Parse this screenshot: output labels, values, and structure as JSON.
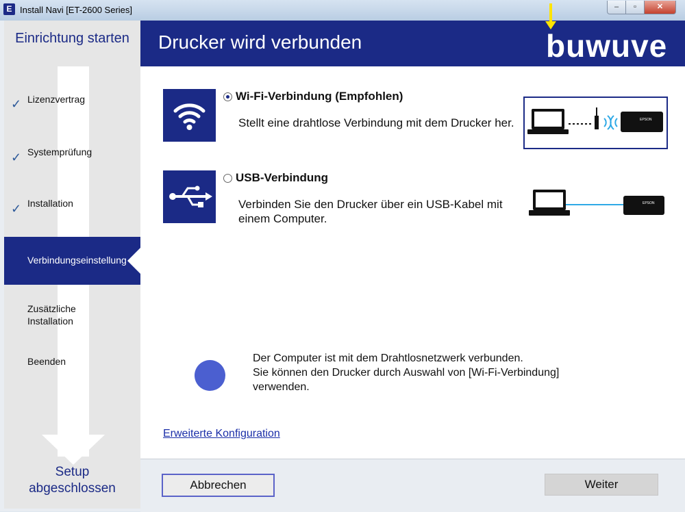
{
  "window": {
    "app_icon": "E",
    "title": "Install Navi [ET-2600 Series]",
    "controls": {
      "minimize": "–",
      "maximize": "▫",
      "close": "✕"
    }
  },
  "sidebar": {
    "title": "Einrichtung starten",
    "steps": [
      {
        "label": "Lizenzvertrag",
        "done": true
      },
      {
        "label": "Systemprüfung",
        "done": true
      },
      {
        "label": "Installation",
        "done": true
      },
      {
        "label": "Verbindungseinstellung",
        "active": true
      },
      {
        "label": "Zusätzliche Installation"
      },
      {
        "label": "Beenden"
      }
    ],
    "footer_line1": "Setup",
    "footer_line2": "abgeschlossen",
    "check_glyph": "✓"
  },
  "header": {
    "title": "Drucker wird verbunden",
    "brand": "buwuve"
  },
  "options": [
    {
      "icon": "wifi-icon",
      "title": "Wi-Fi-Verbindung (Empfohlen)",
      "desc": "Stellt eine drahtlose Verbindung mit dem Drucker her.",
      "selected": true
    },
    {
      "icon": "usb-icon",
      "title": "USB-Verbindung",
      "desc": "Verbinden Sie den Drucker über ein USB-Kabel mit einem Computer.",
      "selected": false
    }
  ],
  "diagrams": {
    "printer_label": "EPSON"
  },
  "info": {
    "line1": "Der Computer ist mit dem Drahtlosnetzwerk verbunden.",
    "line2": "Sie können den Drucker durch Auswahl von [Wi-Fi-Verbindung]",
    "line3": "verwenden."
  },
  "advanced_link": "Erweiterte Konfiguration",
  "buttons": {
    "cancel": "Abbrechen",
    "next": "Weiter"
  },
  "colors": {
    "brand_blue": "#1b2a86",
    "info_dot": "#4b5fd0",
    "link": "#1a2ea8",
    "highlight_arrow": "#ffe400"
  }
}
